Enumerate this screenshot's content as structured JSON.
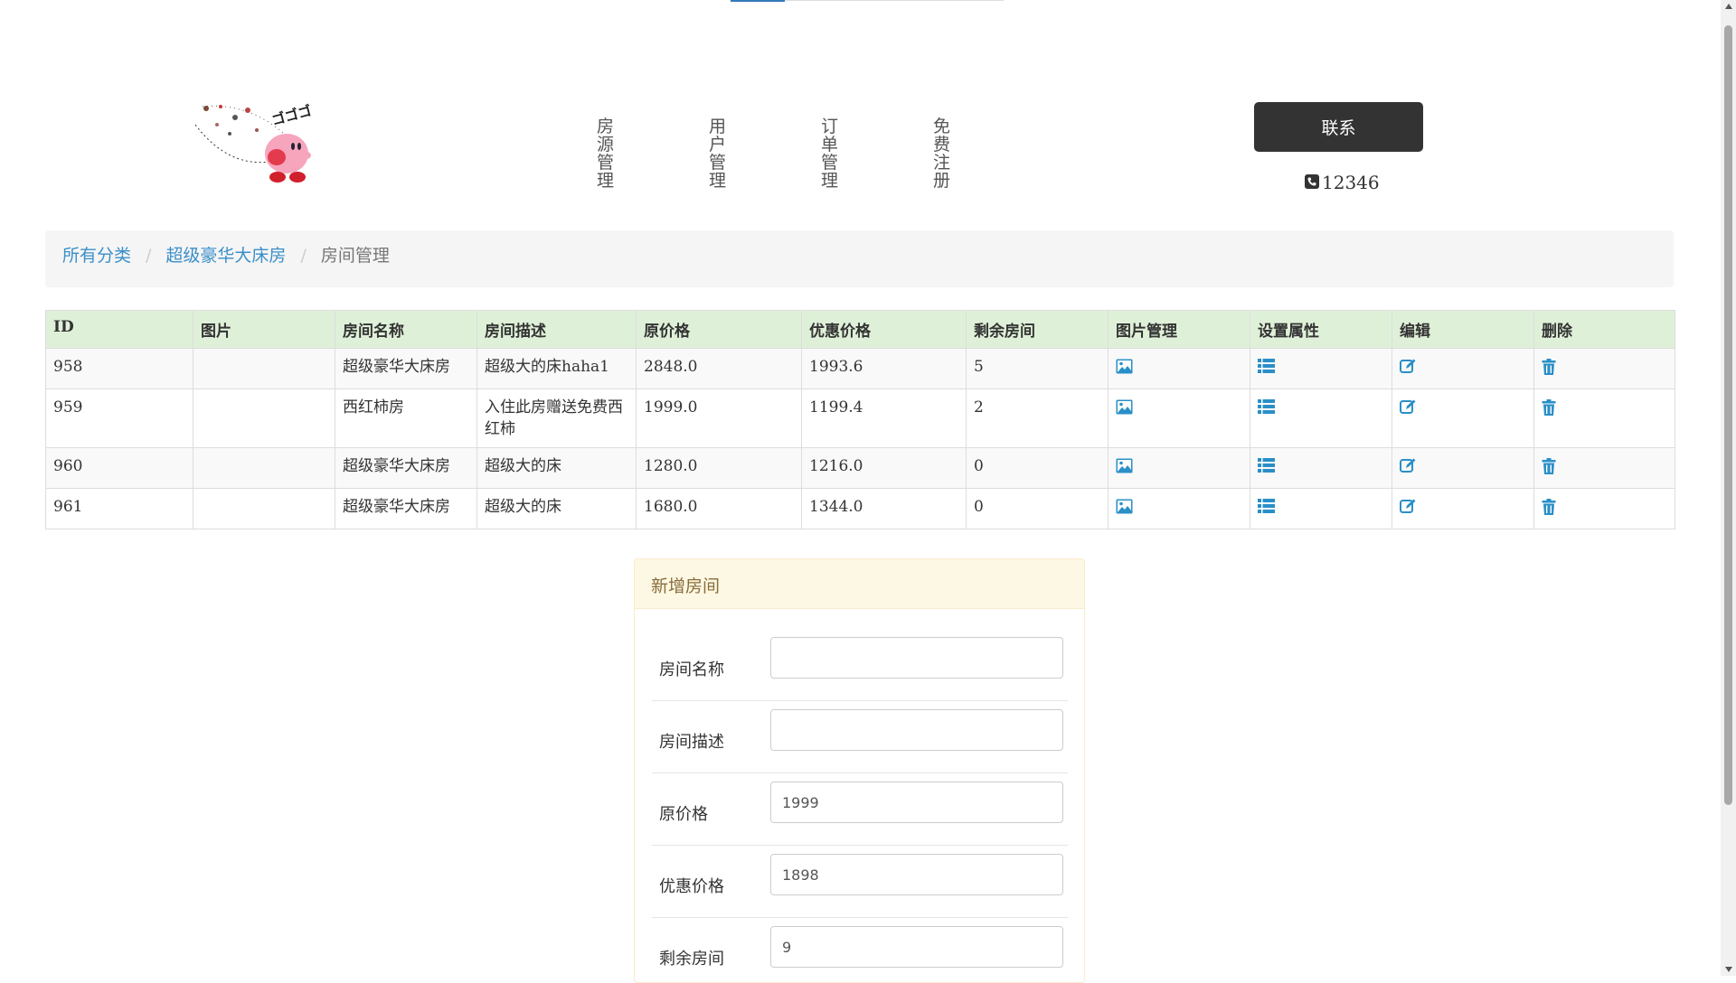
{
  "header": {
    "logo_icon": "kirby-logo-icon",
    "nav": [
      "房源管理",
      "用户管理",
      "订单管理",
      "免费注册"
    ],
    "contact_label": "联系",
    "phone_icon": "phone-icon",
    "phone": "12346"
  },
  "breadcrumb": {
    "items": [
      "所有分类",
      "超级豪华大床房"
    ],
    "active": "房间管理"
  },
  "table": {
    "columns": [
      "ID",
      "图片",
      "房间名称",
      "房间描述",
      "原价格",
      "优惠价格",
      "剩余房间",
      "图片管理",
      "设置属性",
      "编辑",
      "删除"
    ],
    "rows": [
      {
        "id": "958",
        "image": "",
        "name": "超级豪华大床房",
        "desc": "超级大的床haha1",
        "price": "2848.0",
        "discount": "1993.6",
        "remaining": "5"
      },
      {
        "id": "959",
        "image": "",
        "name": "西红柿房",
        "desc": "入住此房赠送免费西红柿",
        "price": "1999.0",
        "discount": "1199.4",
        "remaining": "2"
      },
      {
        "id": "960",
        "image": "",
        "name": "超级豪华大床房",
        "desc": "超级大的床",
        "price": "1280.0",
        "discount": "1216.0",
        "remaining": "0"
      },
      {
        "id": "961",
        "image": "",
        "name": "超级豪华大床房",
        "desc": "超级大的床",
        "price": "1680.0",
        "discount": "1344.0",
        "remaining": "0"
      }
    ],
    "action_icons": [
      "picture-icon",
      "list-icon",
      "edit-icon",
      "trash-icon"
    ],
    "icon_color": "#2a8fc7",
    "header_bg": "#dff0d8"
  },
  "form": {
    "title": "新增房间",
    "fields": [
      {
        "label": "房间名称",
        "value": ""
      },
      {
        "label": "房间描述",
        "value": ""
      },
      {
        "label": "原价格",
        "value": "1999"
      },
      {
        "label": "优惠价格",
        "value": "1898"
      },
      {
        "label": "剩余房间",
        "value": "9"
      }
    ]
  }
}
